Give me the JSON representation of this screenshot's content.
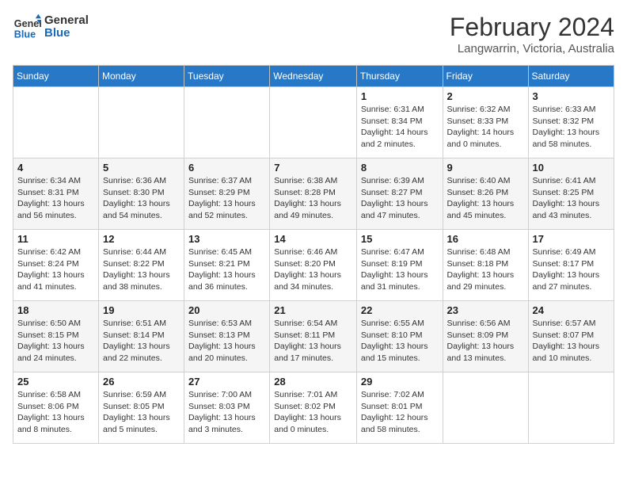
{
  "logo": {
    "line1": "General",
    "line2": "Blue"
  },
  "title": "February 2024",
  "subtitle": "Langwarrin, Victoria, Australia",
  "days_header": [
    "Sunday",
    "Monday",
    "Tuesday",
    "Wednesday",
    "Thursday",
    "Friday",
    "Saturday"
  ],
  "weeks": [
    [
      {
        "day": "",
        "info": ""
      },
      {
        "day": "",
        "info": ""
      },
      {
        "day": "",
        "info": ""
      },
      {
        "day": "",
        "info": ""
      },
      {
        "day": "1",
        "info": "Sunrise: 6:31 AM\nSunset: 8:34 PM\nDaylight: 14 hours\nand 2 minutes."
      },
      {
        "day": "2",
        "info": "Sunrise: 6:32 AM\nSunset: 8:33 PM\nDaylight: 14 hours\nand 0 minutes."
      },
      {
        "day": "3",
        "info": "Sunrise: 6:33 AM\nSunset: 8:32 PM\nDaylight: 13 hours\nand 58 minutes."
      }
    ],
    [
      {
        "day": "4",
        "info": "Sunrise: 6:34 AM\nSunset: 8:31 PM\nDaylight: 13 hours\nand 56 minutes."
      },
      {
        "day": "5",
        "info": "Sunrise: 6:36 AM\nSunset: 8:30 PM\nDaylight: 13 hours\nand 54 minutes."
      },
      {
        "day": "6",
        "info": "Sunrise: 6:37 AM\nSunset: 8:29 PM\nDaylight: 13 hours\nand 52 minutes."
      },
      {
        "day": "7",
        "info": "Sunrise: 6:38 AM\nSunset: 8:28 PM\nDaylight: 13 hours\nand 49 minutes."
      },
      {
        "day": "8",
        "info": "Sunrise: 6:39 AM\nSunset: 8:27 PM\nDaylight: 13 hours\nand 47 minutes."
      },
      {
        "day": "9",
        "info": "Sunrise: 6:40 AM\nSunset: 8:26 PM\nDaylight: 13 hours\nand 45 minutes."
      },
      {
        "day": "10",
        "info": "Sunrise: 6:41 AM\nSunset: 8:25 PM\nDaylight: 13 hours\nand 43 minutes."
      }
    ],
    [
      {
        "day": "11",
        "info": "Sunrise: 6:42 AM\nSunset: 8:24 PM\nDaylight: 13 hours\nand 41 minutes."
      },
      {
        "day": "12",
        "info": "Sunrise: 6:44 AM\nSunset: 8:22 PM\nDaylight: 13 hours\nand 38 minutes."
      },
      {
        "day": "13",
        "info": "Sunrise: 6:45 AM\nSunset: 8:21 PM\nDaylight: 13 hours\nand 36 minutes."
      },
      {
        "day": "14",
        "info": "Sunrise: 6:46 AM\nSunset: 8:20 PM\nDaylight: 13 hours\nand 34 minutes."
      },
      {
        "day": "15",
        "info": "Sunrise: 6:47 AM\nSunset: 8:19 PM\nDaylight: 13 hours\nand 31 minutes."
      },
      {
        "day": "16",
        "info": "Sunrise: 6:48 AM\nSunset: 8:18 PM\nDaylight: 13 hours\nand 29 minutes."
      },
      {
        "day": "17",
        "info": "Sunrise: 6:49 AM\nSunset: 8:17 PM\nDaylight: 13 hours\nand 27 minutes."
      }
    ],
    [
      {
        "day": "18",
        "info": "Sunrise: 6:50 AM\nSunset: 8:15 PM\nDaylight: 13 hours\nand 24 minutes."
      },
      {
        "day": "19",
        "info": "Sunrise: 6:51 AM\nSunset: 8:14 PM\nDaylight: 13 hours\nand 22 minutes."
      },
      {
        "day": "20",
        "info": "Sunrise: 6:53 AM\nSunset: 8:13 PM\nDaylight: 13 hours\nand 20 minutes."
      },
      {
        "day": "21",
        "info": "Sunrise: 6:54 AM\nSunset: 8:11 PM\nDaylight: 13 hours\nand 17 minutes."
      },
      {
        "day": "22",
        "info": "Sunrise: 6:55 AM\nSunset: 8:10 PM\nDaylight: 13 hours\nand 15 minutes."
      },
      {
        "day": "23",
        "info": "Sunrise: 6:56 AM\nSunset: 8:09 PM\nDaylight: 13 hours\nand 13 minutes."
      },
      {
        "day": "24",
        "info": "Sunrise: 6:57 AM\nSunset: 8:07 PM\nDaylight: 13 hours\nand 10 minutes."
      }
    ],
    [
      {
        "day": "25",
        "info": "Sunrise: 6:58 AM\nSunset: 8:06 PM\nDaylight: 13 hours\nand 8 minutes."
      },
      {
        "day": "26",
        "info": "Sunrise: 6:59 AM\nSunset: 8:05 PM\nDaylight: 13 hours\nand 5 minutes."
      },
      {
        "day": "27",
        "info": "Sunrise: 7:00 AM\nSunset: 8:03 PM\nDaylight: 13 hours\nand 3 minutes."
      },
      {
        "day": "28",
        "info": "Sunrise: 7:01 AM\nSunset: 8:02 PM\nDaylight: 13 hours\nand 0 minutes."
      },
      {
        "day": "29",
        "info": "Sunrise: 7:02 AM\nSunset: 8:01 PM\nDaylight: 12 hours\nand 58 minutes."
      },
      {
        "day": "",
        "info": ""
      },
      {
        "day": "",
        "info": ""
      }
    ]
  ]
}
